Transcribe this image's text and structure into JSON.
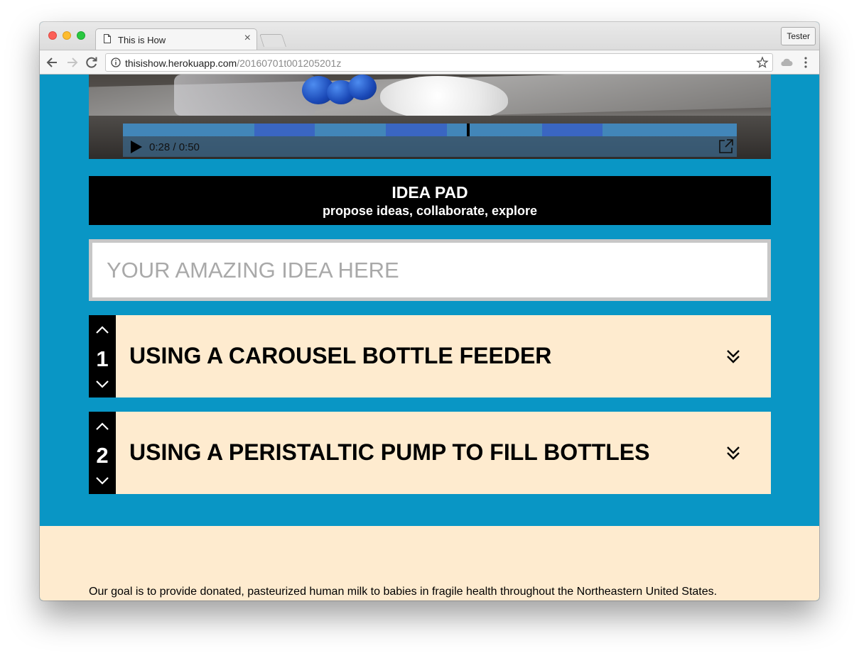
{
  "browser": {
    "tab_title": "This is How",
    "tab_close": "×",
    "profile_label": "Tester",
    "url_host": "thisishow.herokuapp.com",
    "url_path": "/20160701t001205201z"
  },
  "video": {
    "time_display": "0:28 / 0:50",
    "progress": 0.56
  },
  "ideapad": {
    "title": "IDEA PAD",
    "subtitle": "propose ideas, collaborate, explore",
    "input_placeholder": "YOUR AMAZING IDEA HERE"
  },
  "ideas": [
    {
      "rank": "1",
      "title": "USING A CAROUSEL BOTTLE FEEDER"
    },
    {
      "rank": "2",
      "title": "USING A PERISTALTIC PUMP TO FILL BOTTLES"
    }
  ],
  "footer": {
    "text": "Our goal is to provide donated, pasteurized human milk to babies in fragile health throughout the Northeastern United States."
  },
  "colors": {
    "page_background": "#0996c5",
    "card_background": "#feebcf",
    "header_background": "#000000",
    "progress_bar": "#4286b9"
  }
}
